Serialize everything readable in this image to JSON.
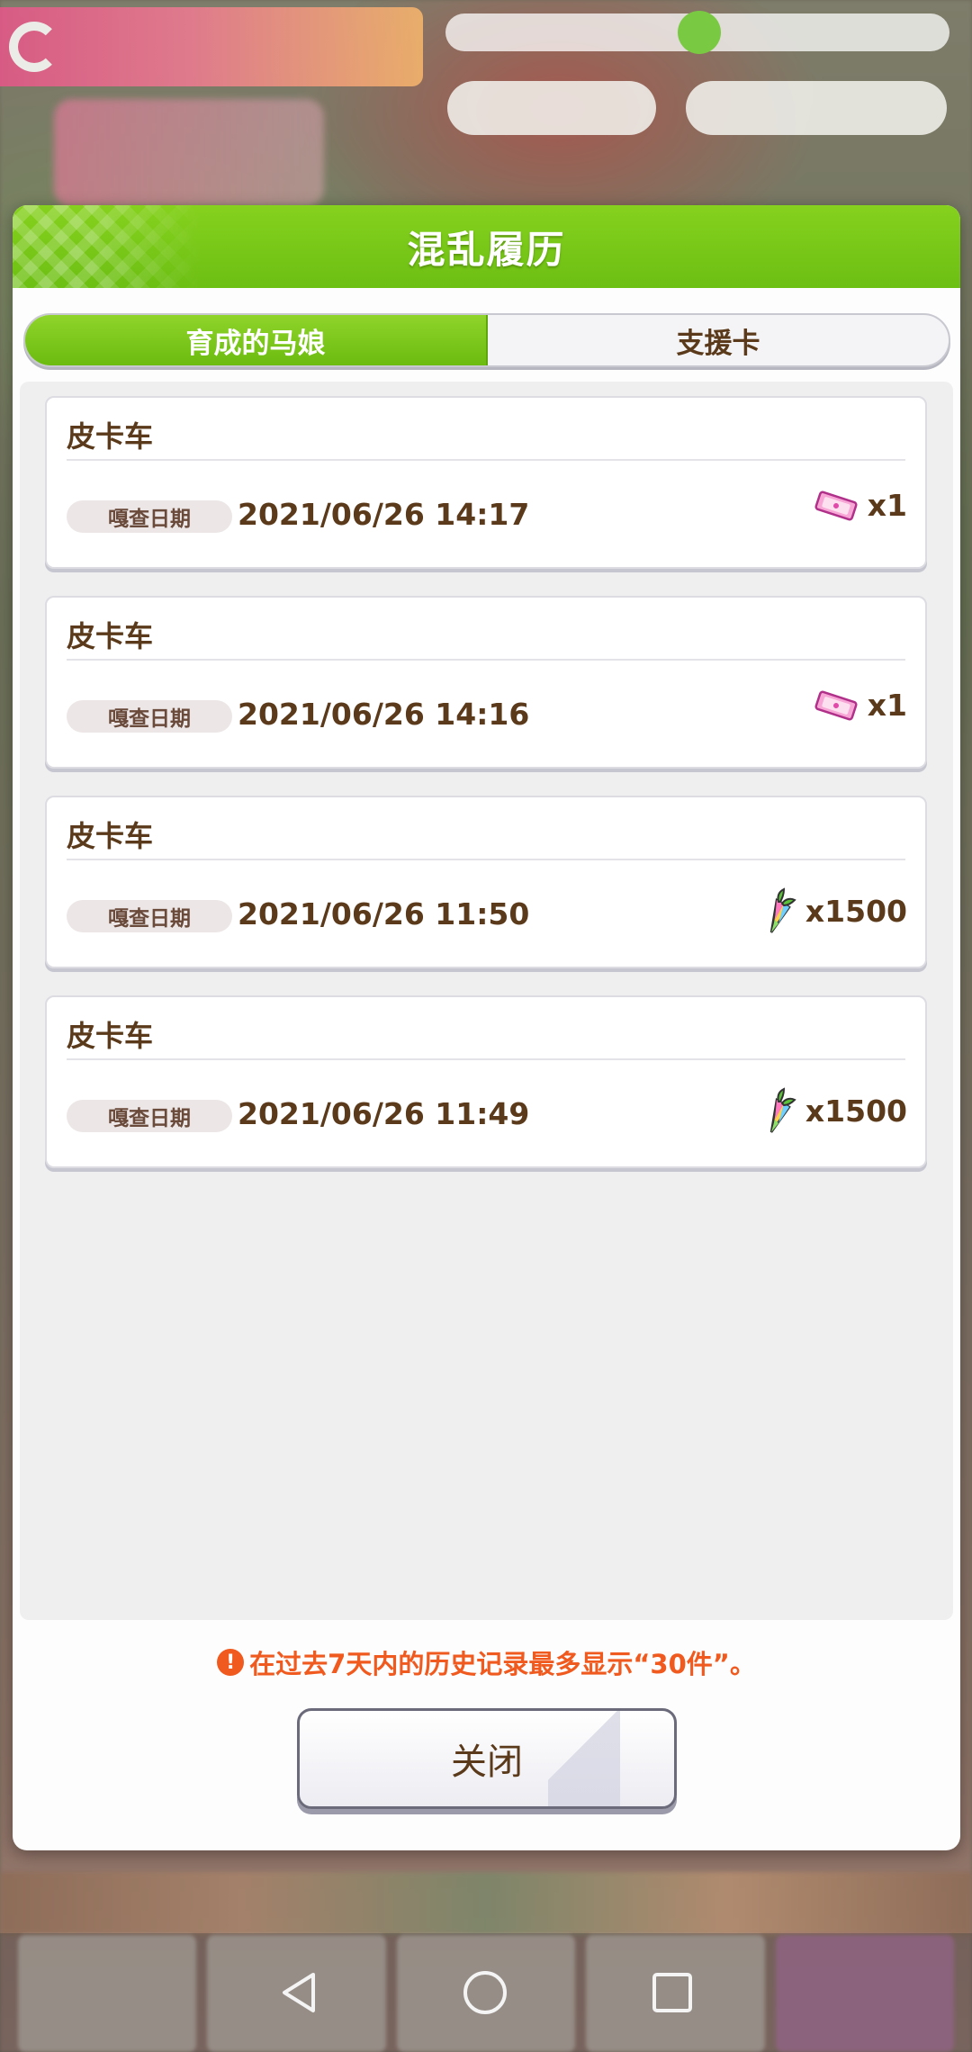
{
  "dialog": {
    "title": "混乱履历",
    "tabs": [
      {
        "label": "育成的马娘",
        "active": true
      },
      {
        "label": "支援卡",
        "active": false
      }
    ],
    "records": [
      {
        "name": "皮卡车",
        "tag": "嘎查日期",
        "date": "2021/06/26 14:17",
        "reward_icon": "ticket-icon",
        "quantity": "x1"
      },
      {
        "name": "皮卡车",
        "tag": "嘎查日期",
        "date": "2021/06/26 14:16",
        "reward_icon": "ticket-icon",
        "quantity": "x1"
      },
      {
        "name": "皮卡车",
        "tag": "嘎查日期",
        "date": "2021/06/26 11:50",
        "reward_icon": "carrot-icon",
        "quantity": "x1500"
      },
      {
        "name": "皮卡车",
        "tag": "嘎查日期",
        "date": "2021/06/26 11:49",
        "reward_icon": "carrot-icon",
        "quantity": "x1500"
      }
    ],
    "notice": "在过去7天内的历史记录最多显示“30件”。",
    "close_label": "关闭"
  },
  "colors": {
    "header_green": "#6cbf13",
    "text_brown": "#5a3a1a",
    "notice_orange": "#f05a1e"
  },
  "navbar": {
    "icons": [
      "back-icon",
      "home-icon",
      "recent-apps-icon"
    ]
  }
}
